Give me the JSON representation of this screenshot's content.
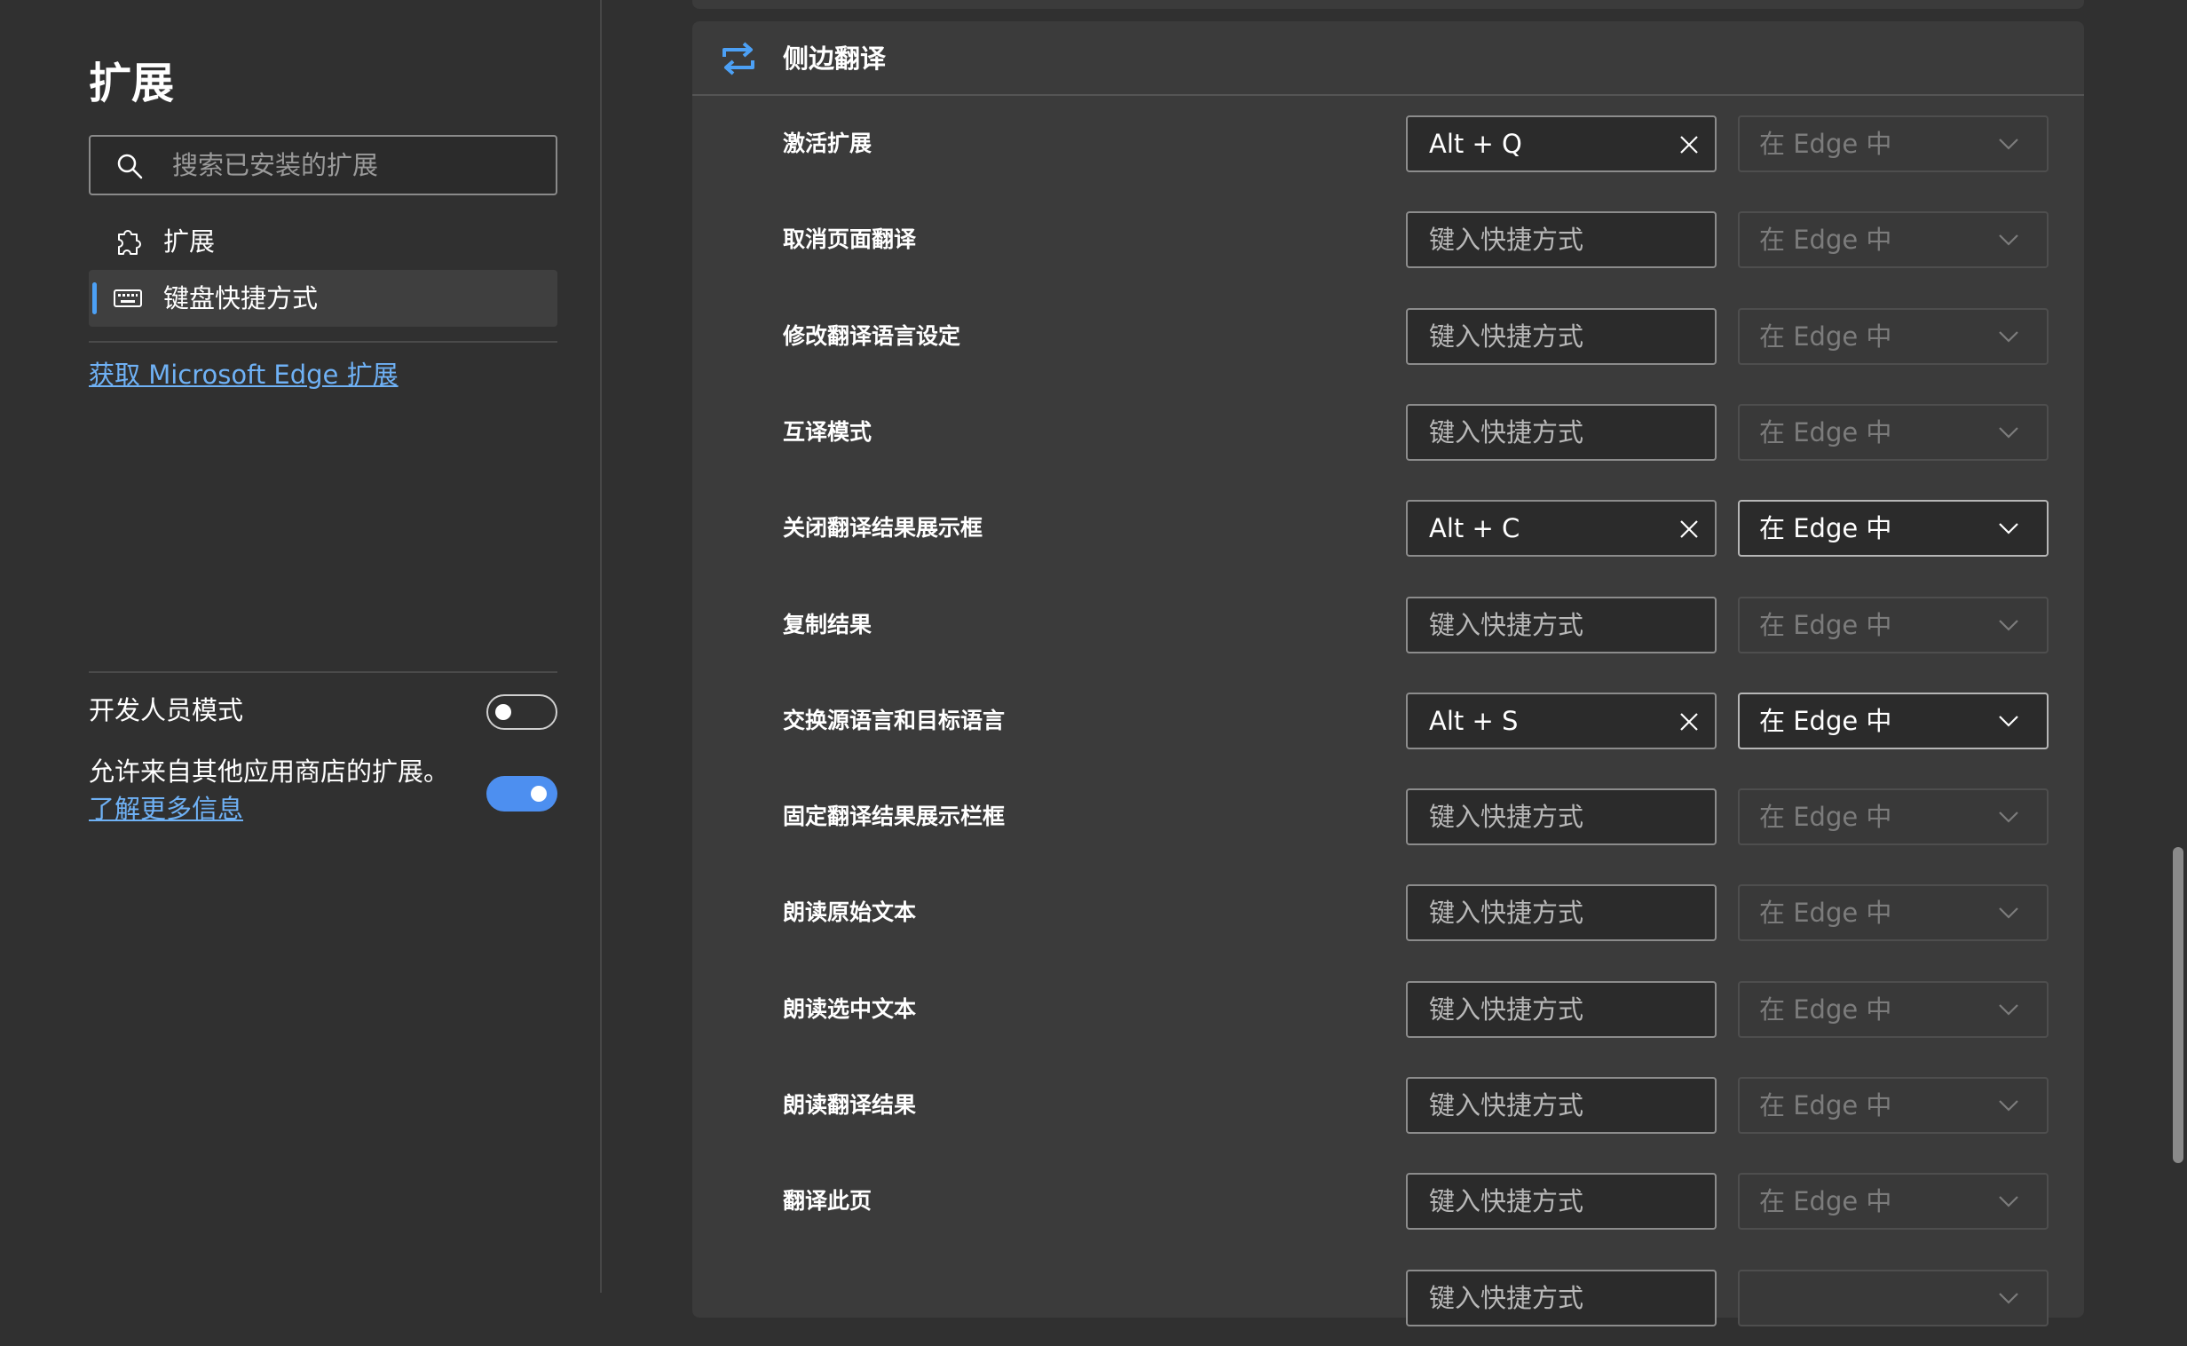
{
  "sidebar": {
    "title": "扩展",
    "search_placeholder": "搜索已安装的扩展",
    "nav_items": [
      {
        "label": "扩展",
        "icon": "puzzle-icon",
        "active": false
      },
      {
        "label": "键盘快捷方式",
        "icon": "keyboard-icon",
        "active": true
      }
    ],
    "store_link": "获取 Microsoft Edge 扩展",
    "developer_mode_label": "开发人员模式",
    "developer_mode_on": false,
    "allow_other_stores_text": "允许来自其他应用商店的扩展。",
    "learn_more_link": "了解更多信息",
    "allow_other_stores_on": true
  },
  "extension": {
    "name": "侧边翻译",
    "icon": "swap-arrows-icon"
  },
  "shortcut_placeholder": "键入快捷方式",
  "shortcuts": [
    {
      "command": "激活扩展",
      "shortcut": "Alt + Q",
      "scope": "在 Edge 中",
      "scope_enabled": false
    },
    {
      "command": "取消页面翻译",
      "shortcut": "",
      "scope": "在 Edge 中",
      "scope_enabled": false
    },
    {
      "command": "修改翻译语言设定",
      "shortcut": "",
      "scope": "在 Edge 中",
      "scope_enabled": false
    },
    {
      "command": "互译模式",
      "shortcut": "",
      "scope": "在 Edge 中",
      "scope_enabled": false
    },
    {
      "command": "关闭翻译结果展示框",
      "shortcut": "Alt + C",
      "scope": "在 Edge 中",
      "scope_enabled": true
    },
    {
      "command": "复制结果",
      "shortcut": "",
      "scope": "在 Edge 中",
      "scope_enabled": false
    },
    {
      "command": "交换源语言和目标语言",
      "shortcut": "Alt + S",
      "scope": "在 Edge 中",
      "scope_enabled": true
    },
    {
      "command": "固定翻译结果展示栏框",
      "shortcut": "",
      "scope": "在 Edge 中",
      "scope_enabled": false
    },
    {
      "command": "朗读原始文本",
      "shortcut": "",
      "scope": "在 Edge 中",
      "scope_enabled": false
    },
    {
      "command": "朗读选中文本",
      "shortcut": "",
      "scope": "在 Edge 中",
      "scope_enabled": false
    },
    {
      "command": "朗读翻译结果",
      "shortcut": "",
      "scope": "在 Edge 中",
      "scope_enabled": false
    },
    {
      "command": "翻译此页",
      "shortcut": "",
      "scope": "在 Edge 中",
      "scope_enabled": false
    },
    {
      "command": "",
      "shortcut": "",
      "scope": "",
      "scope_enabled": false
    }
  ],
  "colors": {
    "background": "#303030",
    "card": "#3b3b3b",
    "accent": "#4ca0f5",
    "link": "#6fb1f5",
    "toggle_on": "#4d8ff0"
  }
}
